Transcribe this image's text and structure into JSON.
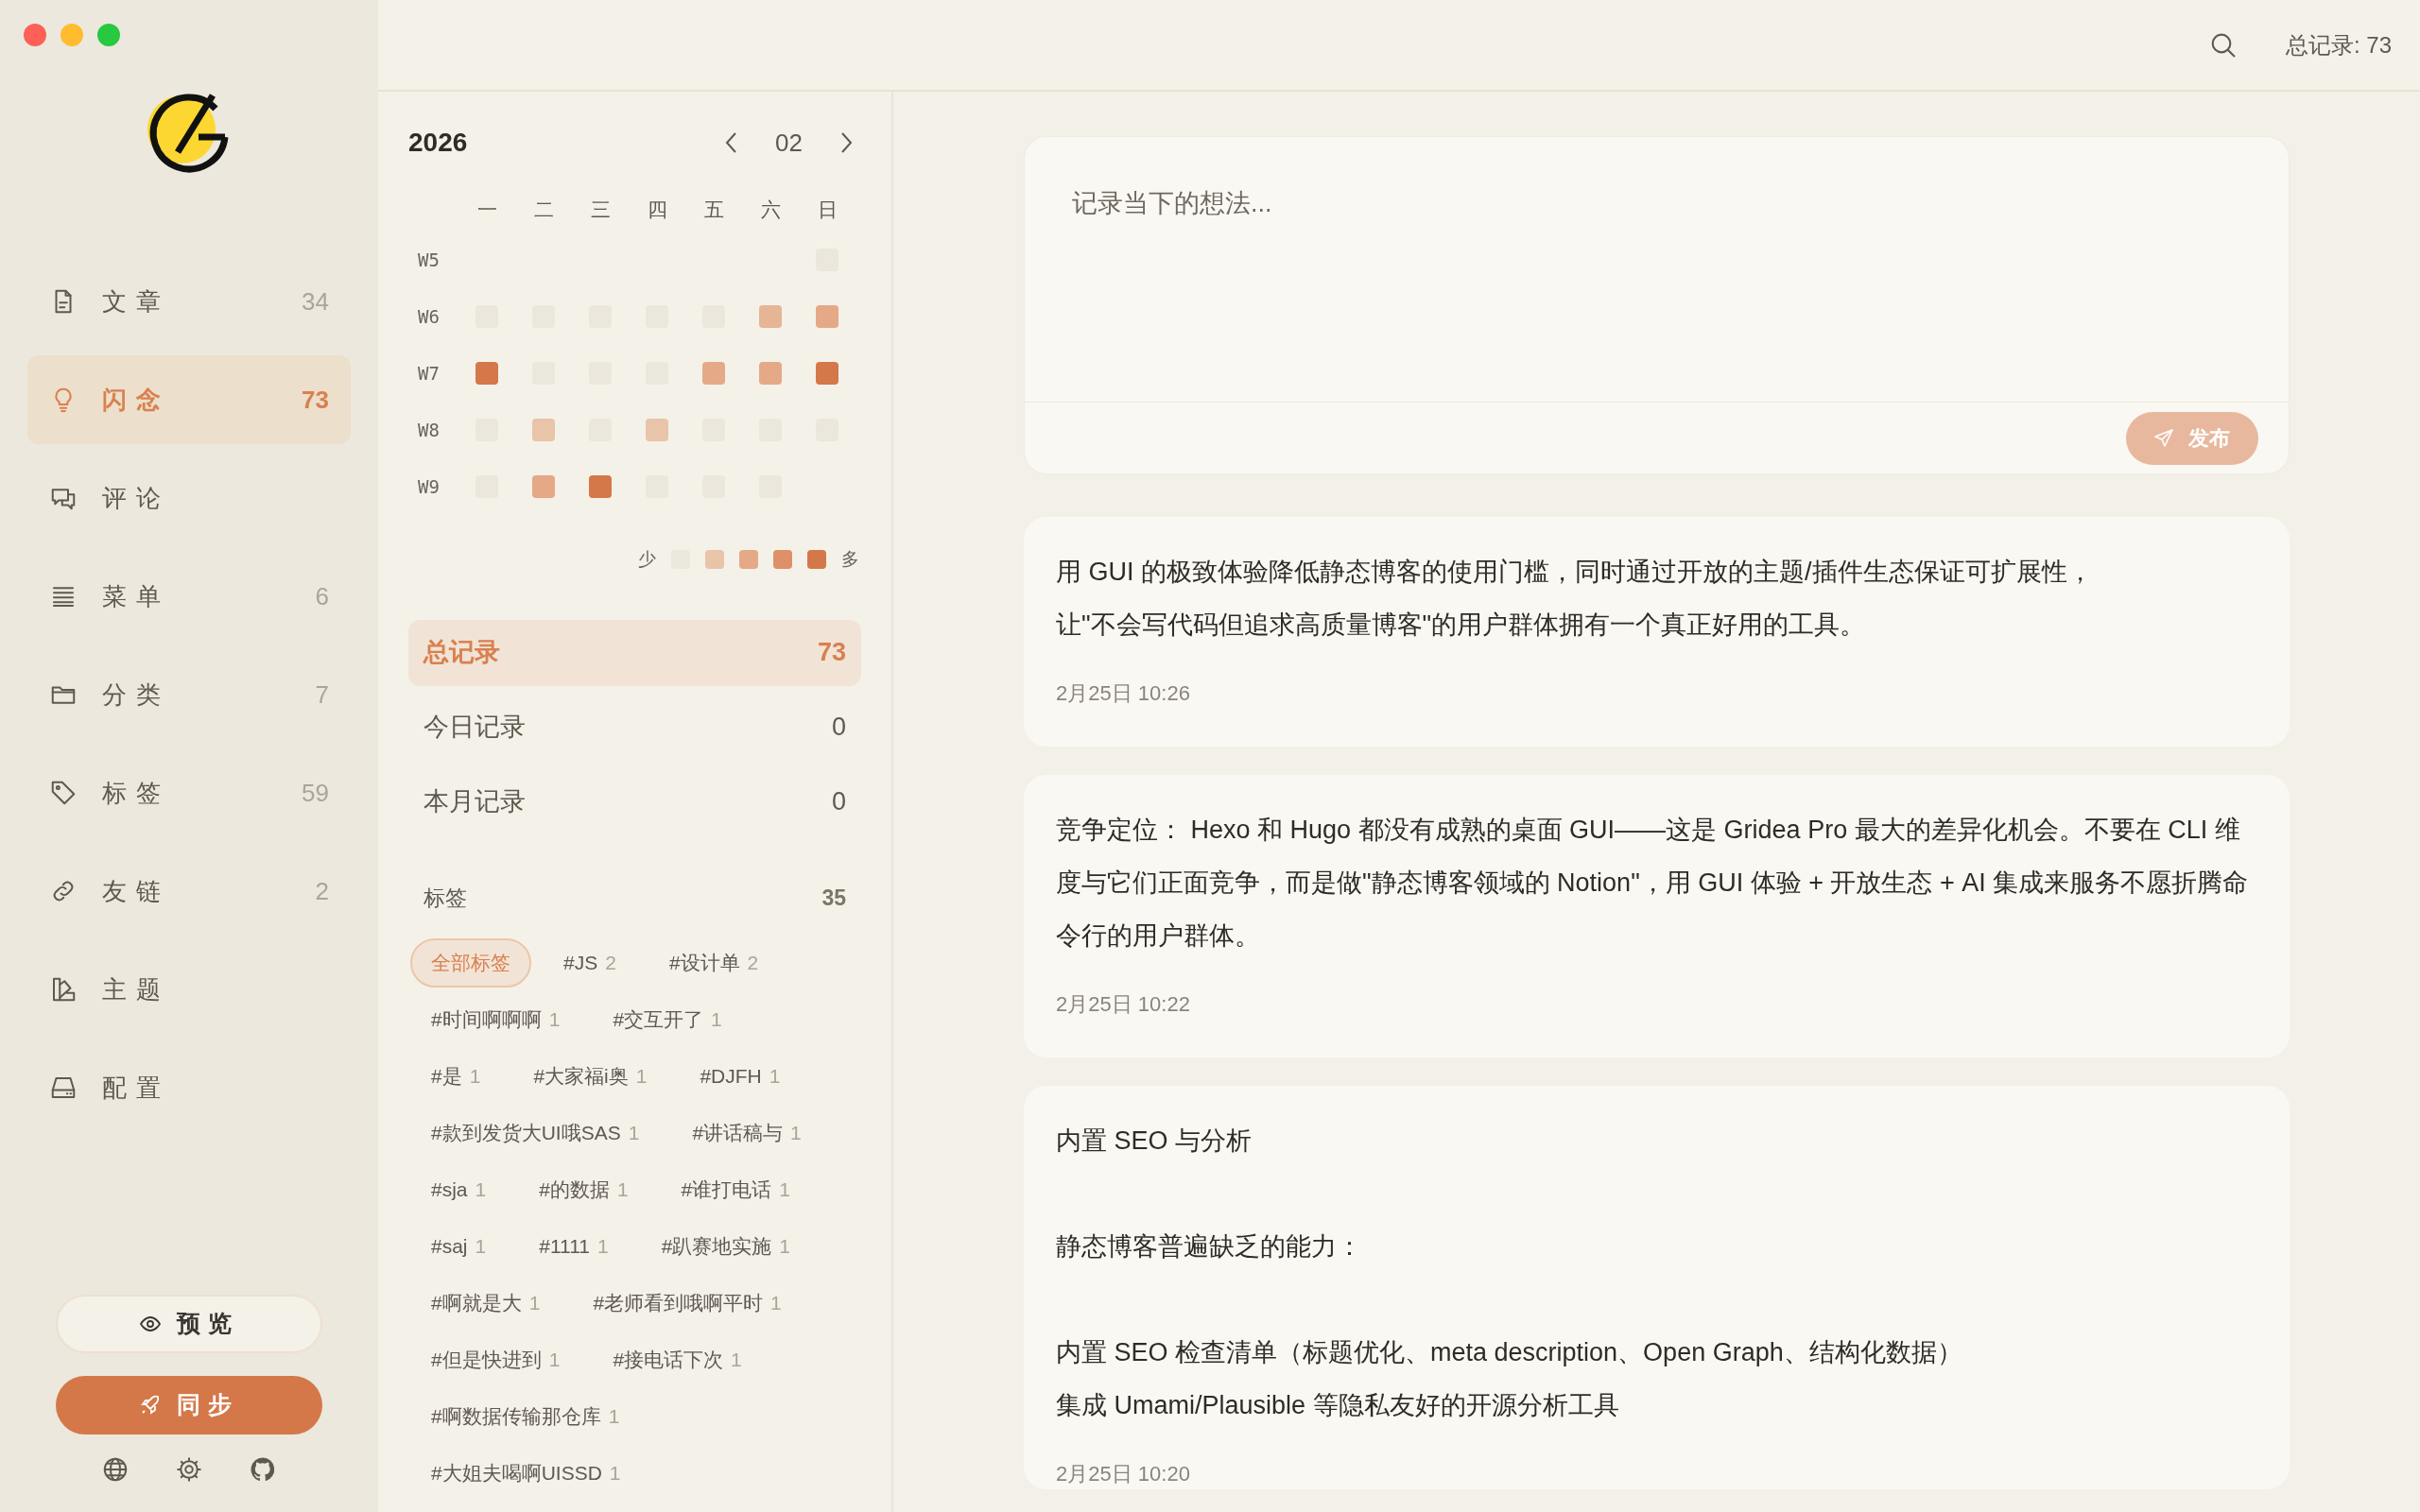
{
  "sidebar": {
    "nav": [
      {
        "kind": "document",
        "label": "文章",
        "count": "34",
        "selected": false
      },
      {
        "kind": "bulb",
        "label": "闪念",
        "count": "73",
        "selected": true
      },
      {
        "kind": "chat",
        "label": "评论",
        "selected": false
      },
      {
        "kind": "list",
        "label": "菜单",
        "count": "6",
        "selected": false
      },
      {
        "kind": "folder",
        "label": "分类",
        "count": "7",
        "selected": false
      },
      {
        "kind": "tag",
        "label": "标签",
        "count": "59",
        "selected": false
      },
      {
        "kind": "link",
        "label": "友链",
        "count": "2",
        "selected": false
      },
      {
        "kind": "theme",
        "label": "主题",
        "selected": false
      },
      {
        "kind": "drive",
        "label": "配置",
        "selected": false
      }
    ],
    "buttons": [
      {
        "kind": "preview",
        "label": "预览"
      },
      {
        "kind": "sync",
        "label": "同步"
      }
    ]
  },
  "calendar": {
    "year": "2026",
    "month": "02",
    "weekdays": [
      "一",
      "二",
      "三",
      "四",
      "五",
      "六",
      "日"
    ],
    "weeks": [
      {
        "label": "W5",
        "days": [
          {
            "kind": "blank"
          },
          {
            "kind": "blank"
          },
          {
            "kind": "blank"
          },
          {
            "kind": "blank"
          },
          {
            "kind": "blank"
          },
          {
            "kind": "blank"
          },
          {
            "kind": "day",
            "color": "#ebe7dc"
          }
        ]
      },
      {
        "label": "W6",
        "days": [
          {
            "kind": "day",
            "color": "#ebe7dc"
          },
          {
            "kind": "day",
            "color": "#ebe7dc"
          },
          {
            "kind": "day",
            "color": "#ebe7dc"
          },
          {
            "kind": "day",
            "color": "#ebe7dc"
          },
          {
            "kind": "day",
            "color": "#ebe7dc"
          },
          {
            "kind": "day",
            "color": "#e5b595"
          },
          {
            "kind": "day",
            "color": "#e5a987"
          }
        ]
      },
      {
        "label": "W7",
        "days": [
          {
            "kind": "day",
            "color": "#d4784a"
          },
          {
            "kind": "day",
            "color": "#ebe7dc"
          },
          {
            "kind": "day",
            "color": "#ebe7dc"
          },
          {
            "kind": "day",
            "color": "#ebe7dc"
          },
          {
            "kind": "day",
            "color": "#e5a987"
          },
          {
            "kind": "day",
            "color": "#e5a987"
          },
          {
            "kind": "day",
            "color": "#d4784a"
          }
        ]
      },
      {
        "label": "W8",
        "days": [
          {
            "kind": "day",
            "color": "#ebe7dc"
          },
          {
            "kind": "day",
            "color": "#e8c4a8"
          },
          {
            "kind": "day",
            "color": "#ebe7dc"
          },
          {
            "kind": "day",
            "color": "#e8c4a8"
          },
          {
            "kind": "day",
            "color": "#ebe7dc"
          },
          {
            "kind": "day",
            "color": "#ebe7dc"
          },
          {
            "kind": "day",
            "color": "#ebe7dc"
          }
        ]
      },
      {
        "label": "W9",
        "days": [
          {
            "kind": "day",
            "color": "#ebe7dc"
          },
          {
            "kind": "day",
            "color": "#e5a987"
          },
          {
            "kind": "day",
            "color": "#d4784a"
          },
          {
            "kind": "day",
            "color": "#ebe7dc"
          },
          {
            "kind": "day",
            "color": "#ebe7dc"
          },
          {
            "kind": "day",
            "color": "#ebe7dc"
          },
          {
            "kind": "blank"
          }
        ]
      }
    ],
    "legend": {
      "less": "少",
      "more": "多",
      "swatches": [
        {
          "color": "#ebe7dc"
        },
        {
          "color": "#e8c4a8"
        },
        {
          "color": "#e5a987"
        },
        {
          "color": "#de9068"
        },
        {
          "color": "#d4784a"
        }
      ]
    }
  },
  "stats": [
    {
      "label": "总记录",
      "count": "73",
      "selected": true
    },
    {
      "label": "今日记录",
      "count": "0",
      "selected": false
    },
    {
      "label": "本月记录",
      "count": "0",
      "selected": false
    }
  ],
  "tags": {
    "title": "标签",
    "count": "35",
    "rows": [
      [
        {
          "name": "全部标签",
          "selected": true
        },
        {
          "name": "#JS",
          "count": "2",
          "selected": false
        },
        {
          "name": "#设计单",
          "count": "2",
          "selected": false
        }
      ],
      [
        {
          "name": "#时间啊啊啊",
          "count": "1",
          "selected": false
        },
        {
          "name": "#交互开了",
          "count": "1",
          "selected": false
        }
      ],
      [
        {
          "name": "#是",
          "count": "1",
          "selected": false
        },
        {
          "name": "#大家福i奥",
          "count": "1",
          "selected": false
        },
        {
          "name": "#DJFH",
          "count": "1",
          "selected": false
        }
      ],
      [
        {
          "name": "#款到发货大UI哦SAS",
          "count": "1",
          "selected": false
        },
        {
          "name": "#讲话稿与",
          "count": "1",
          "selected": false
        }
      ],
      [
        {
          "name": "#sja",
          "count": "1",
          "selected": false
        },
        {
          "name": "#的数据",
          "count": "1",
          "selected": false
        },
        {
          "name": "#谁打电话",
          "count": "1",
          "selected": false
        }
      ],
      [
        {
          "name": "#saj",
          "count": "1",
          "selected": false
        },
        {
          "name": "#1111",
          "count": "1",
          "selected": false
        },
        {
          "name": "#趴赛地实施",
          "count": "1",
          "selected": false
        }
      ],
      [
        {
          "name": "#啊就是大",
          "count": "1",
          "selected": false
        },
        {
          "name": "#老师看到哦啊平时",
          "count": "1",
          "selected": false
        }
      ],
      [
        {
          "name": "#但是快进到",
          "count": "1",
          "selected": false
        },
        {
          "name": "#接电话下次",
          "count": "1",
          "selected": false
        }
      ],
      [
        {
          "name": "#啊数据传输那仓库",
          "count": "1",
          "selected": false
        }
      ],
      [
        {
          "name": "#大姐夫喝啊UISSD",
          "count": "1",
          "selected": false
        }
      ]
    ]
  },
  "topbar": {
    "total": "总记录: 73"
  },
  "composer": {
    "placeholder": "记录当下的想法...",
    "button": "发布",
    "disabled": true
  },
  "posts": [
    {
      "blocks": [
        [
          "用 GUI 的极致体验降低静态博客的使用门槛，同时通过开放的主题/插件生态保证可扩展性，",
          "让\"不会写代码但追求高质量博客\"的用户群体拥有一个真正好用的工具。"
        ]
      ],
      "time": "2月25日 10:26"
    },
    {
      "blocks": [
        [
          "竞争定位： Hexo 和 Hugo 都没有成熟的桌面 GUI——这是 Gridea Pro 最大的差异化机会。不要在 CLI 维度与它们正面竞争，而是做\"静态博客领域的 Notion\"，用 GUI 体验 + 开放生态 + AI 集成来服务不愿折腾命令行的用户群体。"
        ]
      ],
      "time": "2月25日 10:22"
    },
    {
      "blocks": [
        [
          "内置 SEO 与分析"
        ],
        [
          "静态博客普遍缺乏的能力："
        ],
        [
          "内置 SEO 检查清单（标题优化、meta description、Open Graph、结构化数据）",
          "集成 Umami/Plausible 等隐私友好的开源分析工具"
        ]
      ],
      "time": "2月25日 10:20"
    }
  ]
}
